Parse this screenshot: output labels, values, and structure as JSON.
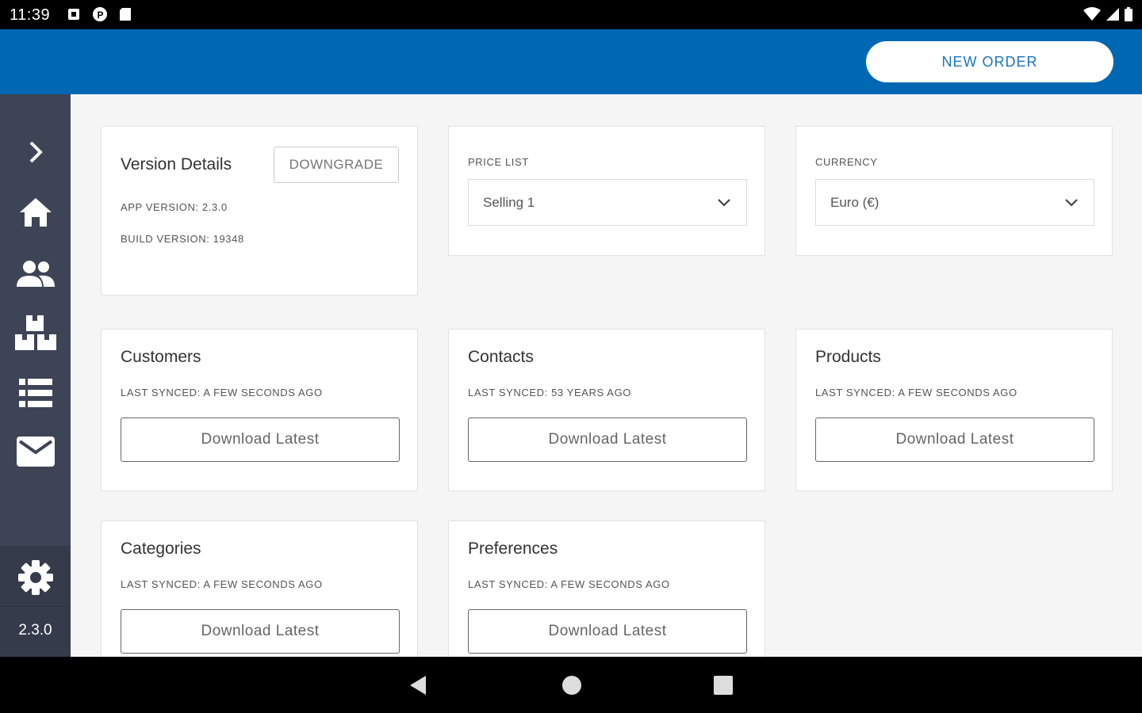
{
  "status_bar": {
    "time": "11:39"
  },
  "header": {
    "new_order_label": "NEW ORDER"
  },
  "sidebar": {
    "version": "2.3.0"
  },
  "version_card": {
    "title": "Version Details",
    "downgrade_label": "DOWNGRADE",
    "app_version": "APP VERSION: 2.3.0",
    "build_version": "BUILD VERSION: 19348"
  },
  "price_list": {
    "label": "PRICE LIST",
    "value": "Selling 1"
  },
  "currency": {
    "label": "CURRENCY",
    "value": "Euro (€)"
  },
  "sync_cards": [
    {
      "title": "Customers",
      "last_synced": "LAST SYNCED: A FEW SECONDS AGO",
      "button": "Download Latest"
    },
    {
      "title": "Contacts",
      "last_synced": "LAST SYNCED: 53 YEARS AGO",
      "button": "Download Latest"
    },
    {
      "title": "Products",
      "last_synced": "LAST SYNCED: A FEW SECONDS AGO",
      "button": "Download Latest"
    },
    {
      "title": "Categories",
      "last_synced": "LAST SYNCED: A FEW SECONDS AGO",
      "button": "Download Latest"
    },
    {
      "title": "Preferences",
      "last_synced": "LAST SYNCED: A FEW SECONDS AGO",
      "button": "Download Latest"
    }
  ],
  "colors": {
    "header": "#0067b3",
    "sidebar": "#3d4456",
    "accent_text": "#1a73c8"
  },
  "icons": {
    "sidebar": [
      "chevron-right-icon",
      "home-icon",
      "people-icon",
      "boxes-icon",
      "list-icon",
      "mail-icon",
      "gear-icon"
    ],
    "nav_bar": [
      "back-icon",
      "home-circle-icon",
      "recents-icon"
    ]
  }
}
